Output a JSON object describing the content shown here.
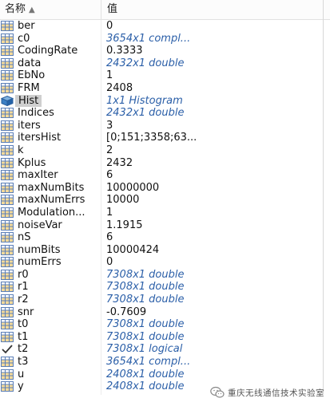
{
  "header": {
    "name_col": "名称",
    "value_col": "值",
    "sort_icon": "sort-ascending-icon"
  },
  "variables": [
    {
      "name": "ber",
      "value": "0",
      "kind": "number",
      "icon": "matrix-icon"
    },
    {
      "name": "c0",
      "value": "3654x1 compl...",
      "kind": "desc",
      "icon": "matrix-icon"
    },
    {
      "name": "CodingRate",
      "value": "0.3333",
      "kind": "number",
      "icon": "matrix-icon"
    },
    {
      "name": "data",
      "value": "2432x1 double",
      "kind": "desc",
      "icon": "matrix-icon"
    },
    {
      "name": "EbNo",
      "value": "1",
      "kind": "number",
      "icon": "matrix-icon"
    },
    {
      "name": "FRM",
      "value": "2408",
      "kind": "number",
      "icon": "matrix-icon"
    },
    {
      "name": "Hist",
      "value": "1x1 Histogram",
      "kind": "desc",
      "icon": "object-icon",
      "selected": true
    },
    {
      "name": "Indices",
      "value": "2432x1 double",
      "kind": "desc",
      "icon": "matrix-icon"
    },
    {
      "name": "iters",
      "value": "3",
      "kind": "number",
      "icon": "matrix-icon"
    },
    {
      "name": "itersHist",
      "value": "[0;151;3358;63...",
      "kind": "number",
      "icon": "matrix-icon"
    },
    {
      "name": "k",
      "value": "2",
      "kind": "number",
      "icon": "matrix-icon"
    },
    {
      "name": "Kplus",
      "value": "2432",
      "kind": "number",
      "icon": "matrix-icon"
    },
    {
      "name": "maxIter",
      "value": "6",
      "kind": "number",
      "icon": "matrix-icon"
    },
    {
      "name": "maxNumBits",
      "value": "10000000",
      "kind": "number",
      "icon": "matrix-icon"
    },
    {
      "name": "maxNumErrs",
      "value": "10000",
      "kind": "number",
      "icon": "matrix-icon"
    },
    {
      "name": "Modulation...",
      "value": "1",
      "kind": "number",
      "icon": "matrix-icon"
    },
    {
      "name": "noiseVar",
      "value": "1.1915",
      "kind": "number",
      "icon": "matrix-icon"
    },
    {
      "name": "nS",
      "value": "6",
      "kind": "number",
      "icon": "matrix-icon"
    },
    {
      "name": "numBits",
      "value": "10000424",
      "kind": "number",
      "icon": "matrix-icon"
    },
    {
      "name": "numErrs",
      "value": "0",
      "kind": "number",
      "icon": "matrix-icon"
    },
    {
      "name": "r0",
      "value": "7308x1 double",
      "kind": "desc",
      "icon": "matrix-icon"
    },
    {
      "name": "r1",
      "value": "7308x1 double",
      "kind": "desc",
      "icon": "matrix-icon"
    },
    {
      "name": "r2",
      "value": "7308x1 double",
      "kind": "desc",
      "icon": "matrix-icon"
    },
    {
      "name": "snr",
      "value": "-0.7609",
      "kind": "number",
      "icon": "matrix-icon"
    },
    {
      "name": "t0",
      "value": "7308x1 double",
      "kind": "desc",
      "icon": "matrix-icon"
    },
    {
      "name": "t1",
      "value": "7308x1 double",
      "kind": "desc",
      "icon": "matrix-icon"
    },
    {
      "name": "t2",
      "value": "7308x1 logical",
      "kind": "desc",
      "icon": "logical-check-icon"
    },
    {
      "name": "t3",
      "value": "3654x1 compl...",
      "kind": "desc",
      "icon": "matrix-icon"
    },
    {
      "name": "u",
      "value": "2408x1 double",
      "kind": "desc",
      "icon": "matrix-icon"
    },
    {
      "name": "y",
      "value": "2408x1 double",
      "kind": "desc",
      "icon": "matrix-icon"
    }
  ],
  "watermark": {
    "text": "重庆无线通信技术实验室",
    "icon": "wechat-logo-icon"
  },
  "colors": {
    "desc_value": "#2b5fa8",
    "selection": "#cfcfcf",
    "grid_icon_border": "#5b7fb8",
    "grid_icon_fill": "#f3d99a"
  }
}
